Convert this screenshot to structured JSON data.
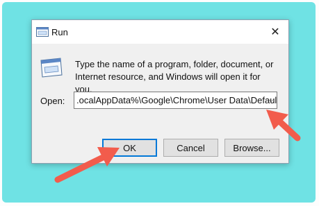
{
  "dialog": {
    "title": "Run",
    "close_glyph": "✕",
    "description": "Type the name of a program, folder, document, or Internet resource, and Windows will open it for you.",
    "open_label": "Open:",
    "open_value": ".ocalAppData%\\Google\\Chrome\\User Data\\Default",
    "dropdown_glyph": "⌵",
    "buttons": {
      "ok": "OK",
      "cancel": "Cancel",
      "browse": "Browse..."
    }
  },
  "colors": {
    "background_accent": "#6fe2e4",
    "arrow": "#f25c4c",
    "focus_border": "#0078d7"
  },
  "icons": [
    "run-icon",
    "close-icon",
    "run-large-icon",
    "dropdown-arrow-icon",
    "annotation-arrow"
  ]
}
